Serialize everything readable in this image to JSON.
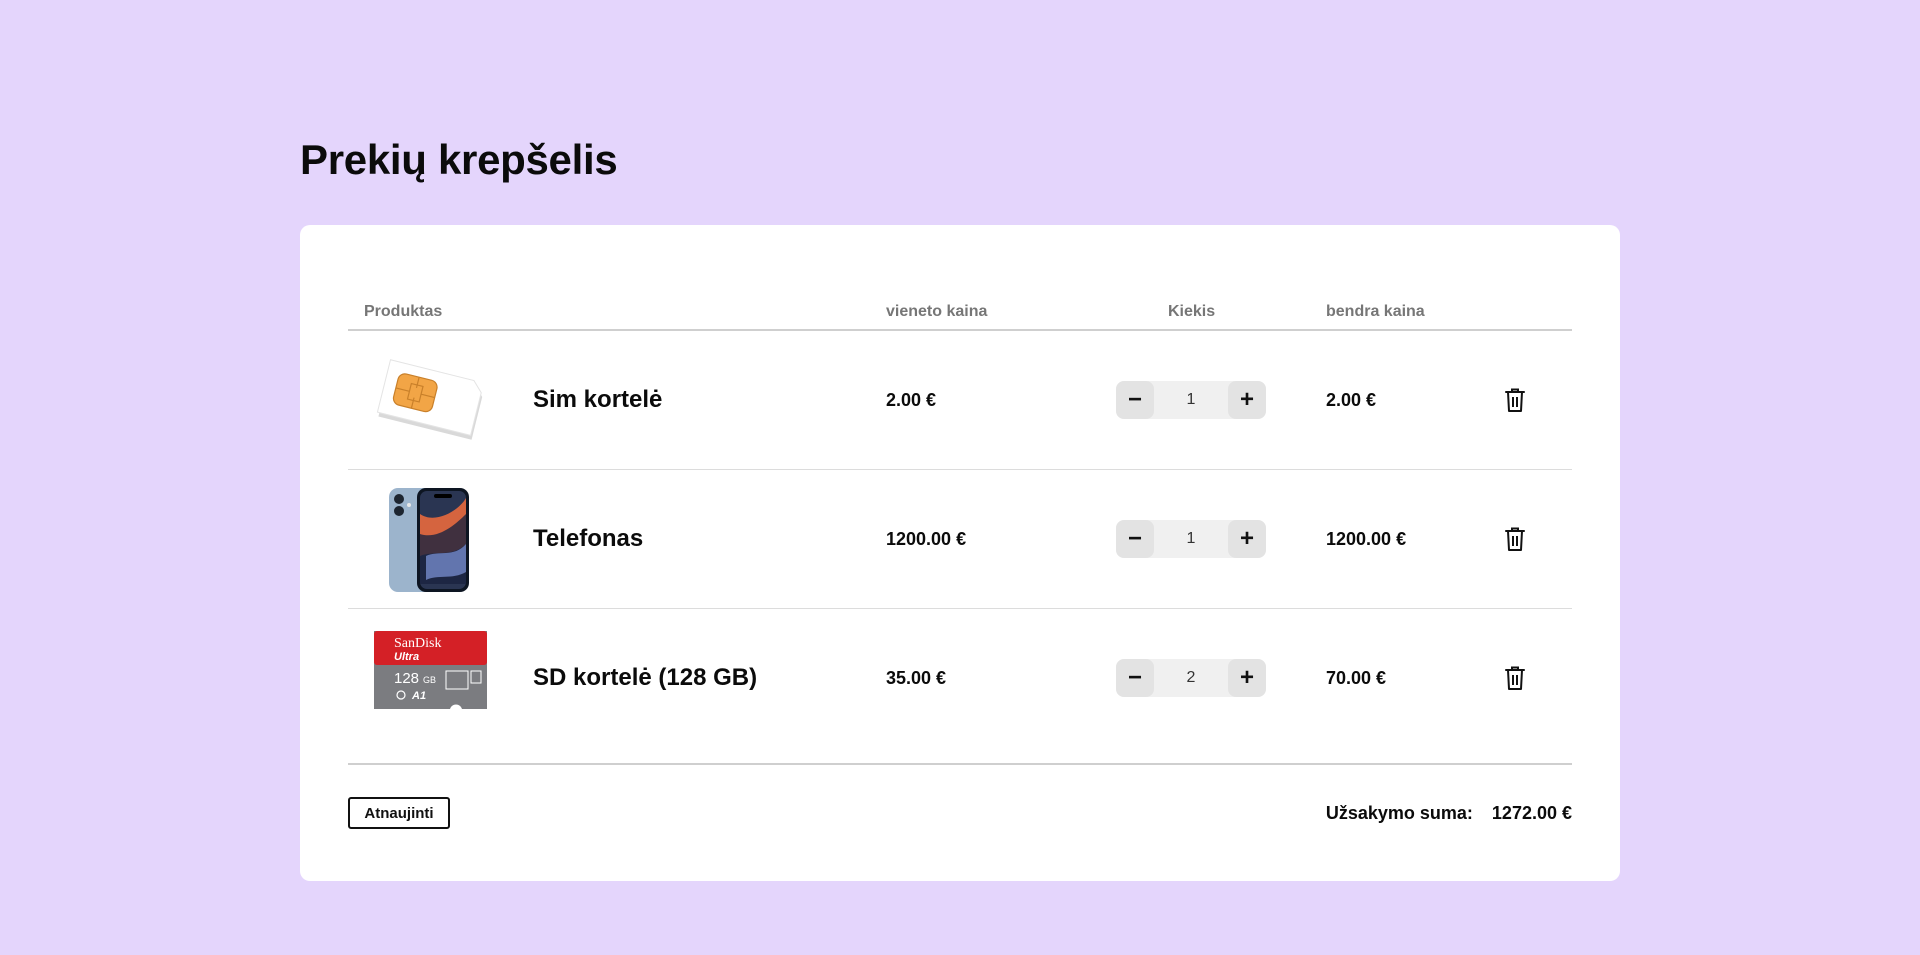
{
  "page": {
    "title": "Prekių krepšelis"
  },
  "table": {
    "headers": {
      "product": "Produktas",
      "unit_price": "vieneto kaina",
      "quantity": "Kiekis",
      "total_price": "bendra kaina"
    },
    "rows": [
      {
        "name": "Sim kortelė",
        "unit_price": "2.00 €",
        "quantity": "1",
        "total": "2.00 €",
        "image": "sim-card"
      },
      {
        "name": "Telefonas",
        "unit_price": "1200.00 €",
        "quantity": "1",
        "total": "1200.00 €",
        "image": "smartphone"
      },
      {
        "name": "SD kortelė (128 GB)",
        "unit_price": "35.00 €",
        "quantity": "2",
        "total": "70.00 €",
        "image": "sd-card"
      }
    ],
    "controls": {
      "decrement": "−",
      "increment": "+"
    }
  },
  "footer": {
    "update_button": "Atnaujinti",
    "order_sum_label": "Užsakymo suma:",
    "order_sum_value": "1272.00 €"
  },
  "sd_card_logo": {
    "brand": "SanDisk",
    "line": "Ultra",
    "capacity": "128",
    "unit": "GB",
    "class": "A1"
  },
  "colors": {
    "background": "#e4d5fc",
    "card": "#ffffff",
    "header_text": "#767676"
  }
}
